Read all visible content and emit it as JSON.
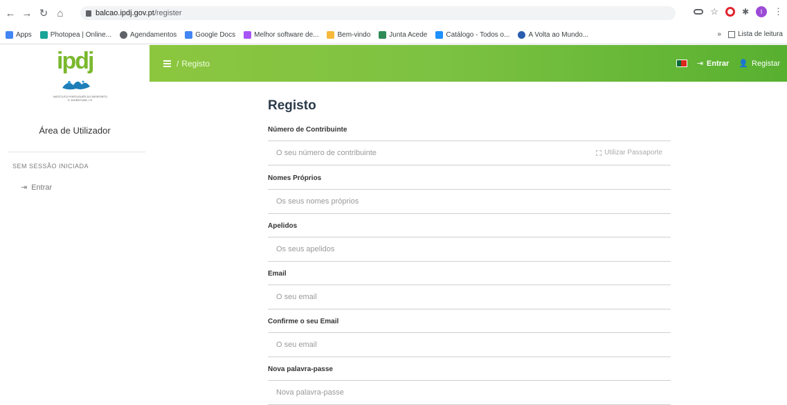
{
  "browser": {
    "url_host": "balcao.ipdj.gov.pt",
    "url_path": "/register",
    "bookmarks": [
      {
        "label": "Apps",
        "color": "#4285f4"
      },
      {
        "label": "Photopea | Online...",
        "color": "#18a497"
      },
      {
        "label": "Agendamentos",
        "color": "#5f6368"
      },
      {
        "label": "Google Docs",
        "color": "#4285f4"
      },
      {
        "label": "Melhor software de...",
        "color": "#a855f7"
      },
      {
        "label": "Bem-vindo",
        "color": "#f6b93b"
      },
      {
        "label": "Junta Acede",
        "color": "#2e8b57"
      },
      {
        "label": "Catálogo - Todos o...",
        "color": "#1e90ff"
      },
      {
        "label": "A Volta ao Mundo...",
        "color": "#2a5db0"
      }
    ],
    "bookmarks_more": "»",
    "reading_list": "Lista de leitura"
  },
  "sidebar": {
    "logo_text": "ipdj",
    "logo_subtitle": "INSTITUTO PORTUGUÊS DO DESPORTO E JUVENTUDE, I.P.",
    "area_title": "Área de Utilizador",
    "session_label": "SEM SESSÃO INICIADA",
    "entrar_label": "Entrar"
  },
  "topbar": {
    "breadcrumb_sep": "/",
    "breadcrumb": "Registo",
    "entrar": "Entrar",
    "registar": "Registar"
  },
  "form": {
    "title": "Registo",
    "fields": [
      {
        "label": "Número de Contribuinte",
        "placeholder": "O seu número de contribuinte",
        "extra": "Utilizar Passaporte"
      },
      {
        "label": "Nomes Próprios",
        "placeholder": "Os seus nomes próprios"
      },
      {
        "label": "Apelidos",
        "placeholder": "Os seus apelidos"
      },
      {
        "label": "Email",
        "placeholder": "O seu email"
      },
      {
        "label": "Confirme o seu Email",
        "placeholder": "O seu email"
      },
      {
        "label": "Nova palavra-passe",
        "placeholder": "Nova palavra-passe"
      }
    ]
  },
  "colors": {
    "topbar_start": "#8cc63f",
    "topbar_end": "#58b030",
    "logo_green": "#7ab82e",
    "title": "#2b3a4a"
  }
}
